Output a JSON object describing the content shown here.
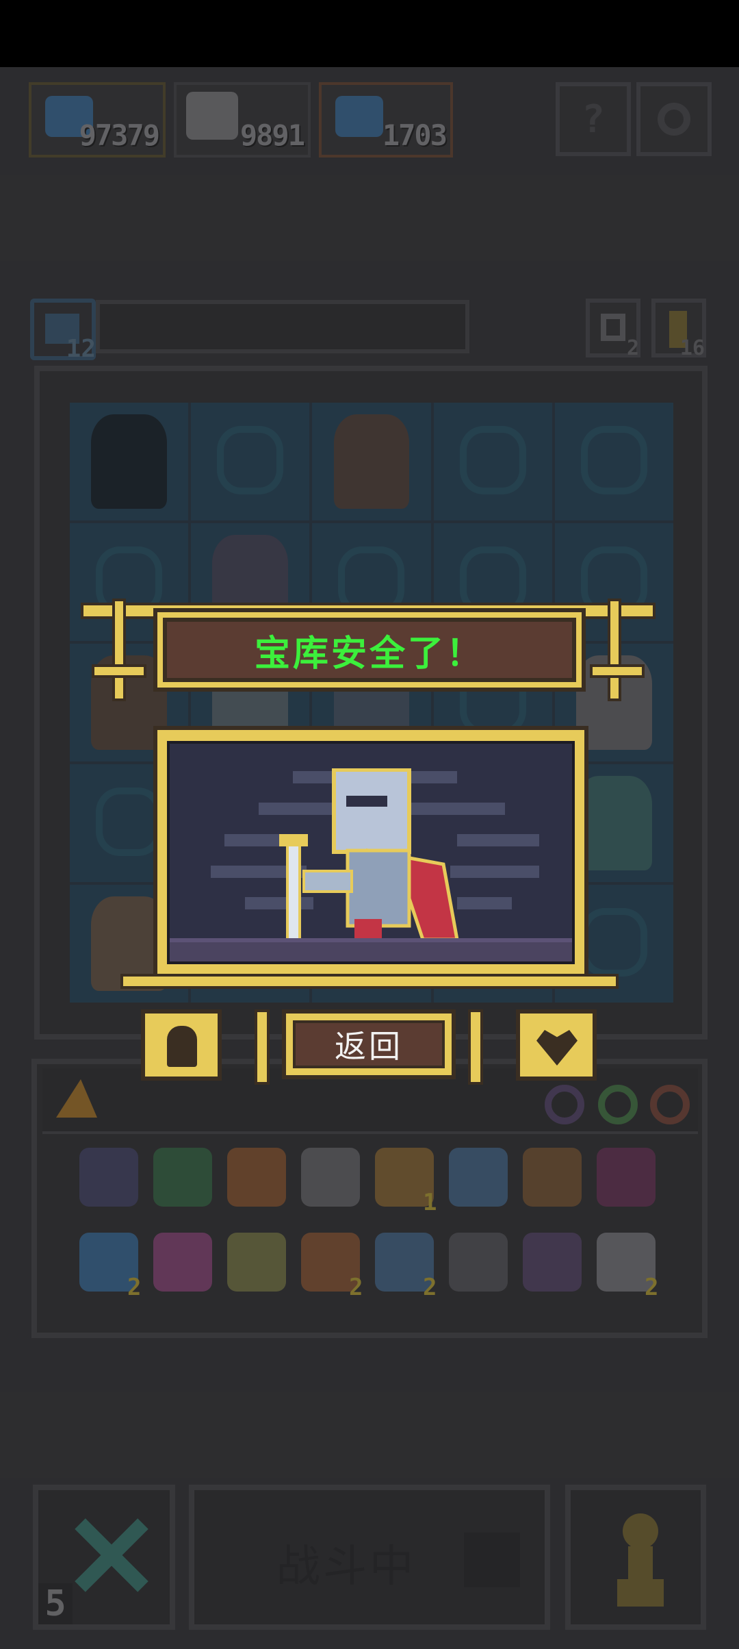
{
  "currencies": [
    {
      "name": "fish",
      "value": "97379",
      "color": "#3f6f9a"
    },
    {
      "name": "elder",
      "value": "9891",
      "color": "#9a9a9a"
    },
    {
      "name": "ghost",
      "value": "1703",
      "color": "#3f6f9a"
    }
  ],
  "top_buttons": {
    "help_label": "?",
    "settings_icon": "gear-icon"
  },
  "toolbar": {
    "left_count": "12",
    "recycle_count": "2",
    "key_count": "16"
  },
  "dialog": {
    "title": "宝库安全了！",
    "return_label": "返回",
    "title_color": "#3cf03c",
    "frame_color": "#e7cb5a"
  },
  "inventory": {
    "items_row1": [
      {
        "name": "shield",
        "count": ""
      },
      {
        "name": "turtle-shell",
        "count": ""
      },
      {
        "name": "armor",
        "count": ""
      },
      {
        "name": "boot",
        "count": ""
      },
      {
        "name": "potion-bag",
        "count": "1"
      },
      {
        "name": "cauldron",
        "count": ""
      },
      {
        "name": "ship",
        "count": ""
      },
      {
        "name": "scroll-cat",
        "count": ""
      }
    ],
    "items_row2": [
      {
        "name": "fish",
        "count": "2"
      },
      {
        "name": "bed",
        "count": ""
      },
      {
        "name": "axe",
        "count": ""
      },
      {
        "name": "staff",
        "count": "2"
      },
      {
        "name": "crystal-ball",
        "count": "2"
      },
      {
        "name": "sword",
        "count": ""
      },
      {
        "name": "flower",
        "count": ""
      },
      {
        "name": "cloud",
        "count": "2"
      }
    ]
  },
  "bottom": {
    "left_count": "5",
    "fight_label": "战斗中"
  }
}
